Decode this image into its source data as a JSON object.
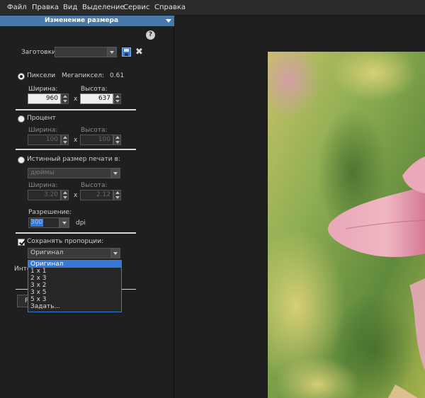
{
  "menu": [
    "Файл",
    "Правка",
    "Вид",
    "Выделение",
    "Сервис",
    "Справка"
  ],
  "panel": {
    "title": "Изменение размера",
    "presets_label": "Заготовки",
    "presets_value": ""
  },
  "pixels": {
    "label": "Пиксели",
    "megapixel_label": "Мегапиксел:",
    "megapixel_value": "0.61",
    "width_label": "Ширина:",
    "height_label": "Высота:",
    "width": "960",
    "height": "637",
    "x": "x"
  },
  "percent": {
    "label": "Процент",
    "width_label": "Ширина:",
    "height_label": "Высота:",
    "width": "100",
    "height": "100",
    "x": "x"
  },
  "print": {
    "label": "Истинный размер печати в:",
    "unit": "дюймы",
    "width_label": "Ширина:",
    "height_label": "Высота:",
    "width": "3.20",
    "height": "2.12",
    "x": "x",
    "resolution_label": "Разрешение:",
    "resolution_value": "300",
    "resolution_unit": "dpi"
  },
  "aspect": {
    "label": "Сохранять пропорции:",
    "selected": "Оригинал",
    "options": [
      "Оригинал",
      "1 x 1",
      "2 x 3",
      "3 x 2",
      "3 x 5",
      "5 x 3",
      "Задать..."
    ],
    "partial_interp_label": "Инте",
    "partial_button_label": "Р"
  },
  "colors": {
    "panel_header": "#4a78a8",
    "selection": "#3578d6",
    "background": "#1e1e1e"
  }
}
